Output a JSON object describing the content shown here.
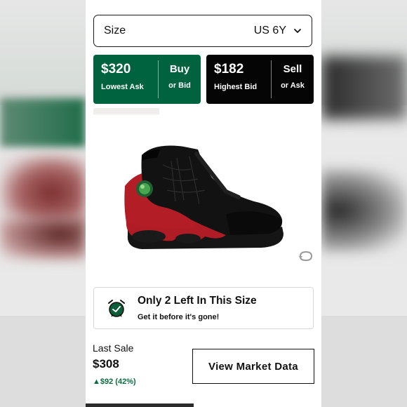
{
  "size_selector": {
    "label": "Size",
    "value": "US 6Y",
    "icon": "chevron-down-icon"
  },
  "lowest_ask": {
    "price": "$320",
    "caption": "Lowest Ask",
    "action": "Buy",
    "action_sub": "or Bid",
    "color": "#006340"
  },
  "highest_bid": {
    "price": "$182",
    "caption": "Highest Bid",
    "action": "Sell",
    "action_sub": "or Ask",
    "color": "#050505"
  },
  "product_image": {
    "icon": "sneaker-image"
  },
  "view_360": {
    "icon": "rotate-360-icon"
  },
  "scarcity": {
    "icon": "alarm-clock-icon",
    "title": "Only 2 Left In This Size",
    "subtitle": "Get it before it's gone!"
  },
  "last_sale": {
    "label": "Last Sale",
    "price": "$308",
    "change": "▲$92 (42%)",
    "change_color": "#0a6b3f"
  },
  "market_button": {
    "label": "View Market Data"
  }
}
